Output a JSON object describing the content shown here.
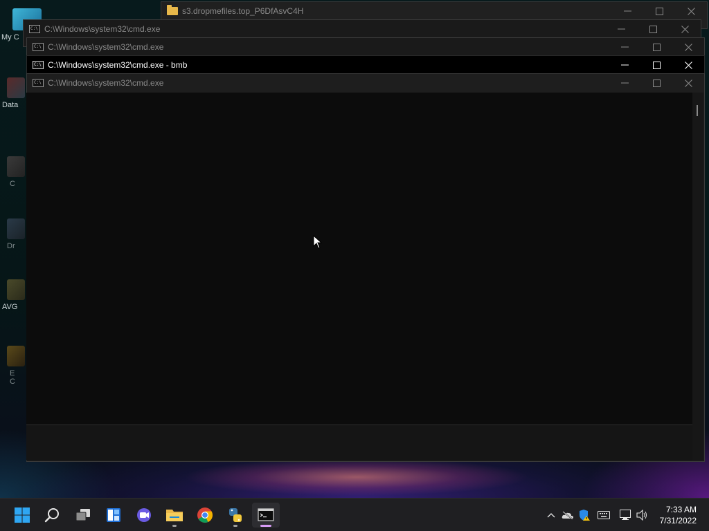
{
  "desktop": {
    "icons": [
      {
        "label": "My C",
        "icon": "computer-icon"
      },
      {
        "label": "Data",
        "icon": "shortcut-icon"
      },
      {
        "label": "C",
        "icon": "shortcut-icon"
      },
      {
        "label": "Dr",
        "icon": "shortcut-icon"
      },
      {
        "label": "AVG",
        "icon": "shortcut-icon"
      },
      {
        "label": "E\nC",
        "icon": "shortcut-icon"
      }
    ]
  },
  "windows": {
    "explorer": {
      "title": "s3.dropmefiles.top_P6DfAsvC4H"
    },
    "cmd1": {
      "title": "C:\\Windows\\system32\\cmd.exe"
    },
    "cmd2": {
      "title": "C:\\Windows\\system32\\cmd.exe"
    },
    "cmd_active": {
      "title": "C:\\Windows\\system32\\cmd.exe - bmb"
    },
    "cmd4": {
      "title": "C:\\Windows\\system32\\cmd.exe"
    }
  },
  "taskbar": {
    "items": [
      "start-icon",
      "search-icon",
      "task-view-icon",
      "widgets-icon",
      "chat-icon",
      "file-explorer-icon",
      "chrome-icon",
      "python-icon",
      "terminal-icon"
    ],
    "clock": {
      "time": "7:33 AM",
      "date": "7/31/2022"
    }
  },
  "colors": {
    "active_titlebar": "#000000",
    "console_bg": "#0c0c0c",
    "taskbar_bg": "#1f1f22"
  }
}
